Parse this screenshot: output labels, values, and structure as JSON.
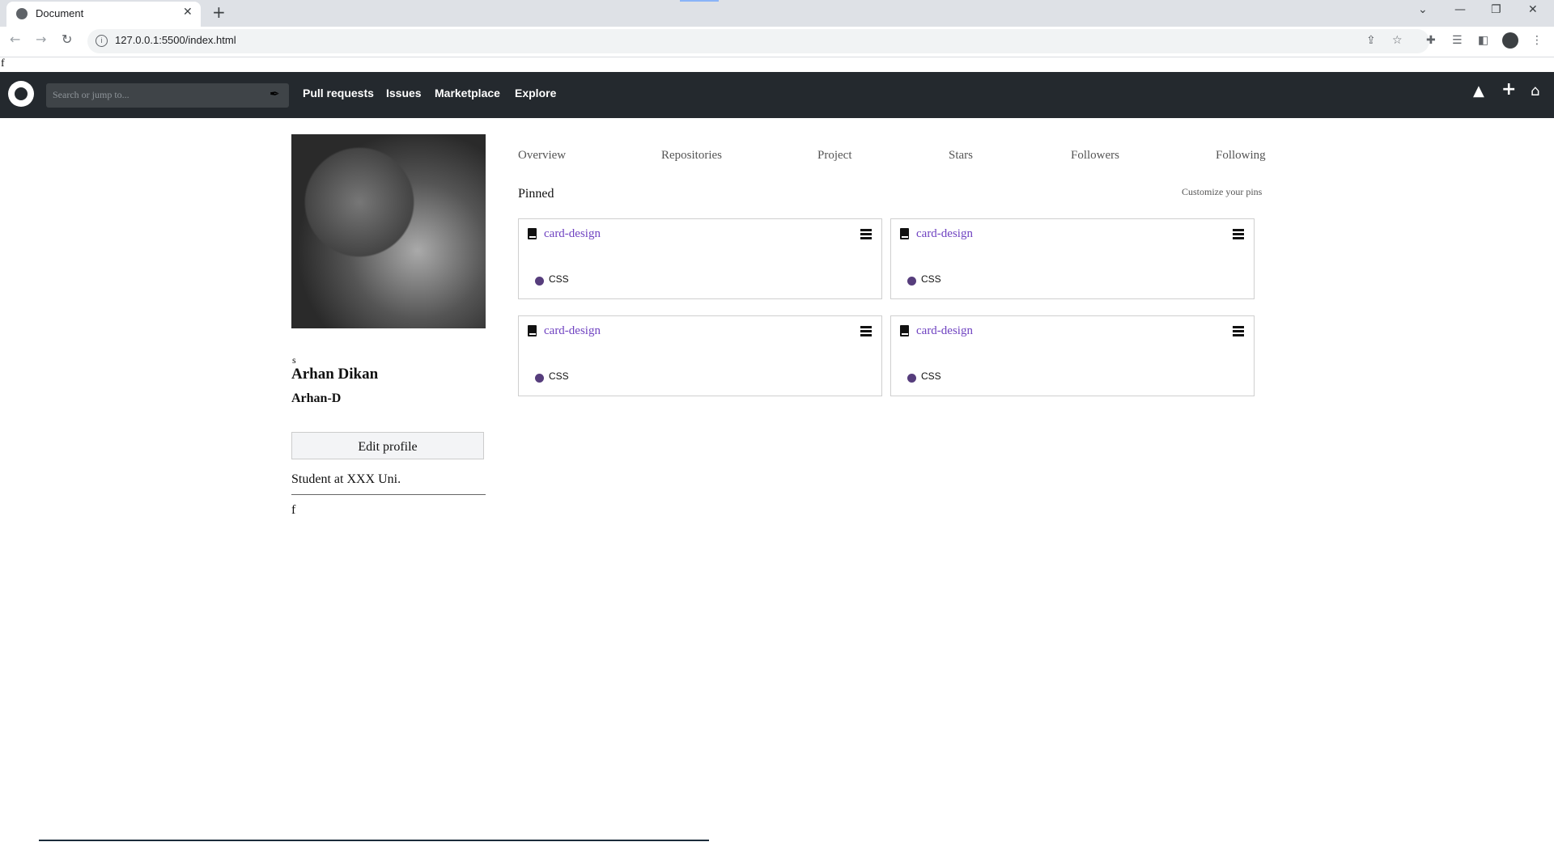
{
  "browser": {
    "tab_title": "Document",
    "url": "127.0.0.1:5500/index.html"
  },
  "page": {
    "stray_text": "f"
  },
  "header": {
    "search_placeholder": "Search or jump to...",
    "nav": [
      "Pull requests",
      "Issues",
      "Marketplace",
      "Explore"
    ]
  },
  "profile": {
    "stray": "s",
    "name": "Arhan Dikan",
    "login": "Arhan-D",
    "edit_label": "Edit profile",
    "bio": "Student at XXX Uni.",
    "extra": "f"
  },
  "tabs": [
    "Overview",
    "Repositories",
    "Project",
    "Stars",
    "Followers",
    "Following"
  ],
  "pinned": {
    "title": "Pinned",
    "customize_label": "Customize your pins",
    "cards": [
      {
        "name": "card-design",
        "language": "CSS"
      },
      {
        "name": "card-design",
        "language": "CSS"
      },
      {
        "name": "card-design",
        "language": "CSS"
      },
      {
        "name": "card-design",
        "language": "CSS"
      }
    ]
  },
  "colors": {
    "header_bg": "#24292e",
    "link": "#6f42c1",
    "css_lang": "#563d7c"
  }
}
